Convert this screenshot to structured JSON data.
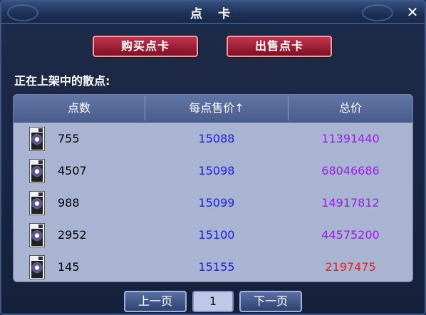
{
  "window": {
    "title": "点 卡",
    "close_label": "✕"
  },
  "actions": {
    "buy_label": "购买点卡",
    "sell_label": "出售点卡"
  },
  "listing": {
    "section_label": "正在上架中的散点:",
    "columns": [
      "点数",
      "每点售价↑",
      "总价"
    ],
    "rows": [
      {
        "points": "755",
        "unit_price": "15088",
        "total": "11391440",
        "total_color": "#9a1fe6"
      },
      {
        "points": "4507",
        "unit_price": "15098",
        "total": "68046686",
        "total_color": "#9a1fe6"
      },
      {
        "points": "988",
        "unit_price": "15099",
        "total": "14917812",
        "total_color": "#9a1fe6"
      },
      {
        "points": "2952",
        "unit_price": "15100",
        "total": "44575200",
        "total_color": "#9a1fe6"
      },
      {
        "points": "145",
        "unit_price": "15155",
        "total": "2197475",
        "total_color": "#ee1a1a"
      }
    ]
  },
  "pagination": {
    "prev_label": "上一页",
    "current_page": "1",
    "next_label": "下一页"
  }
}
